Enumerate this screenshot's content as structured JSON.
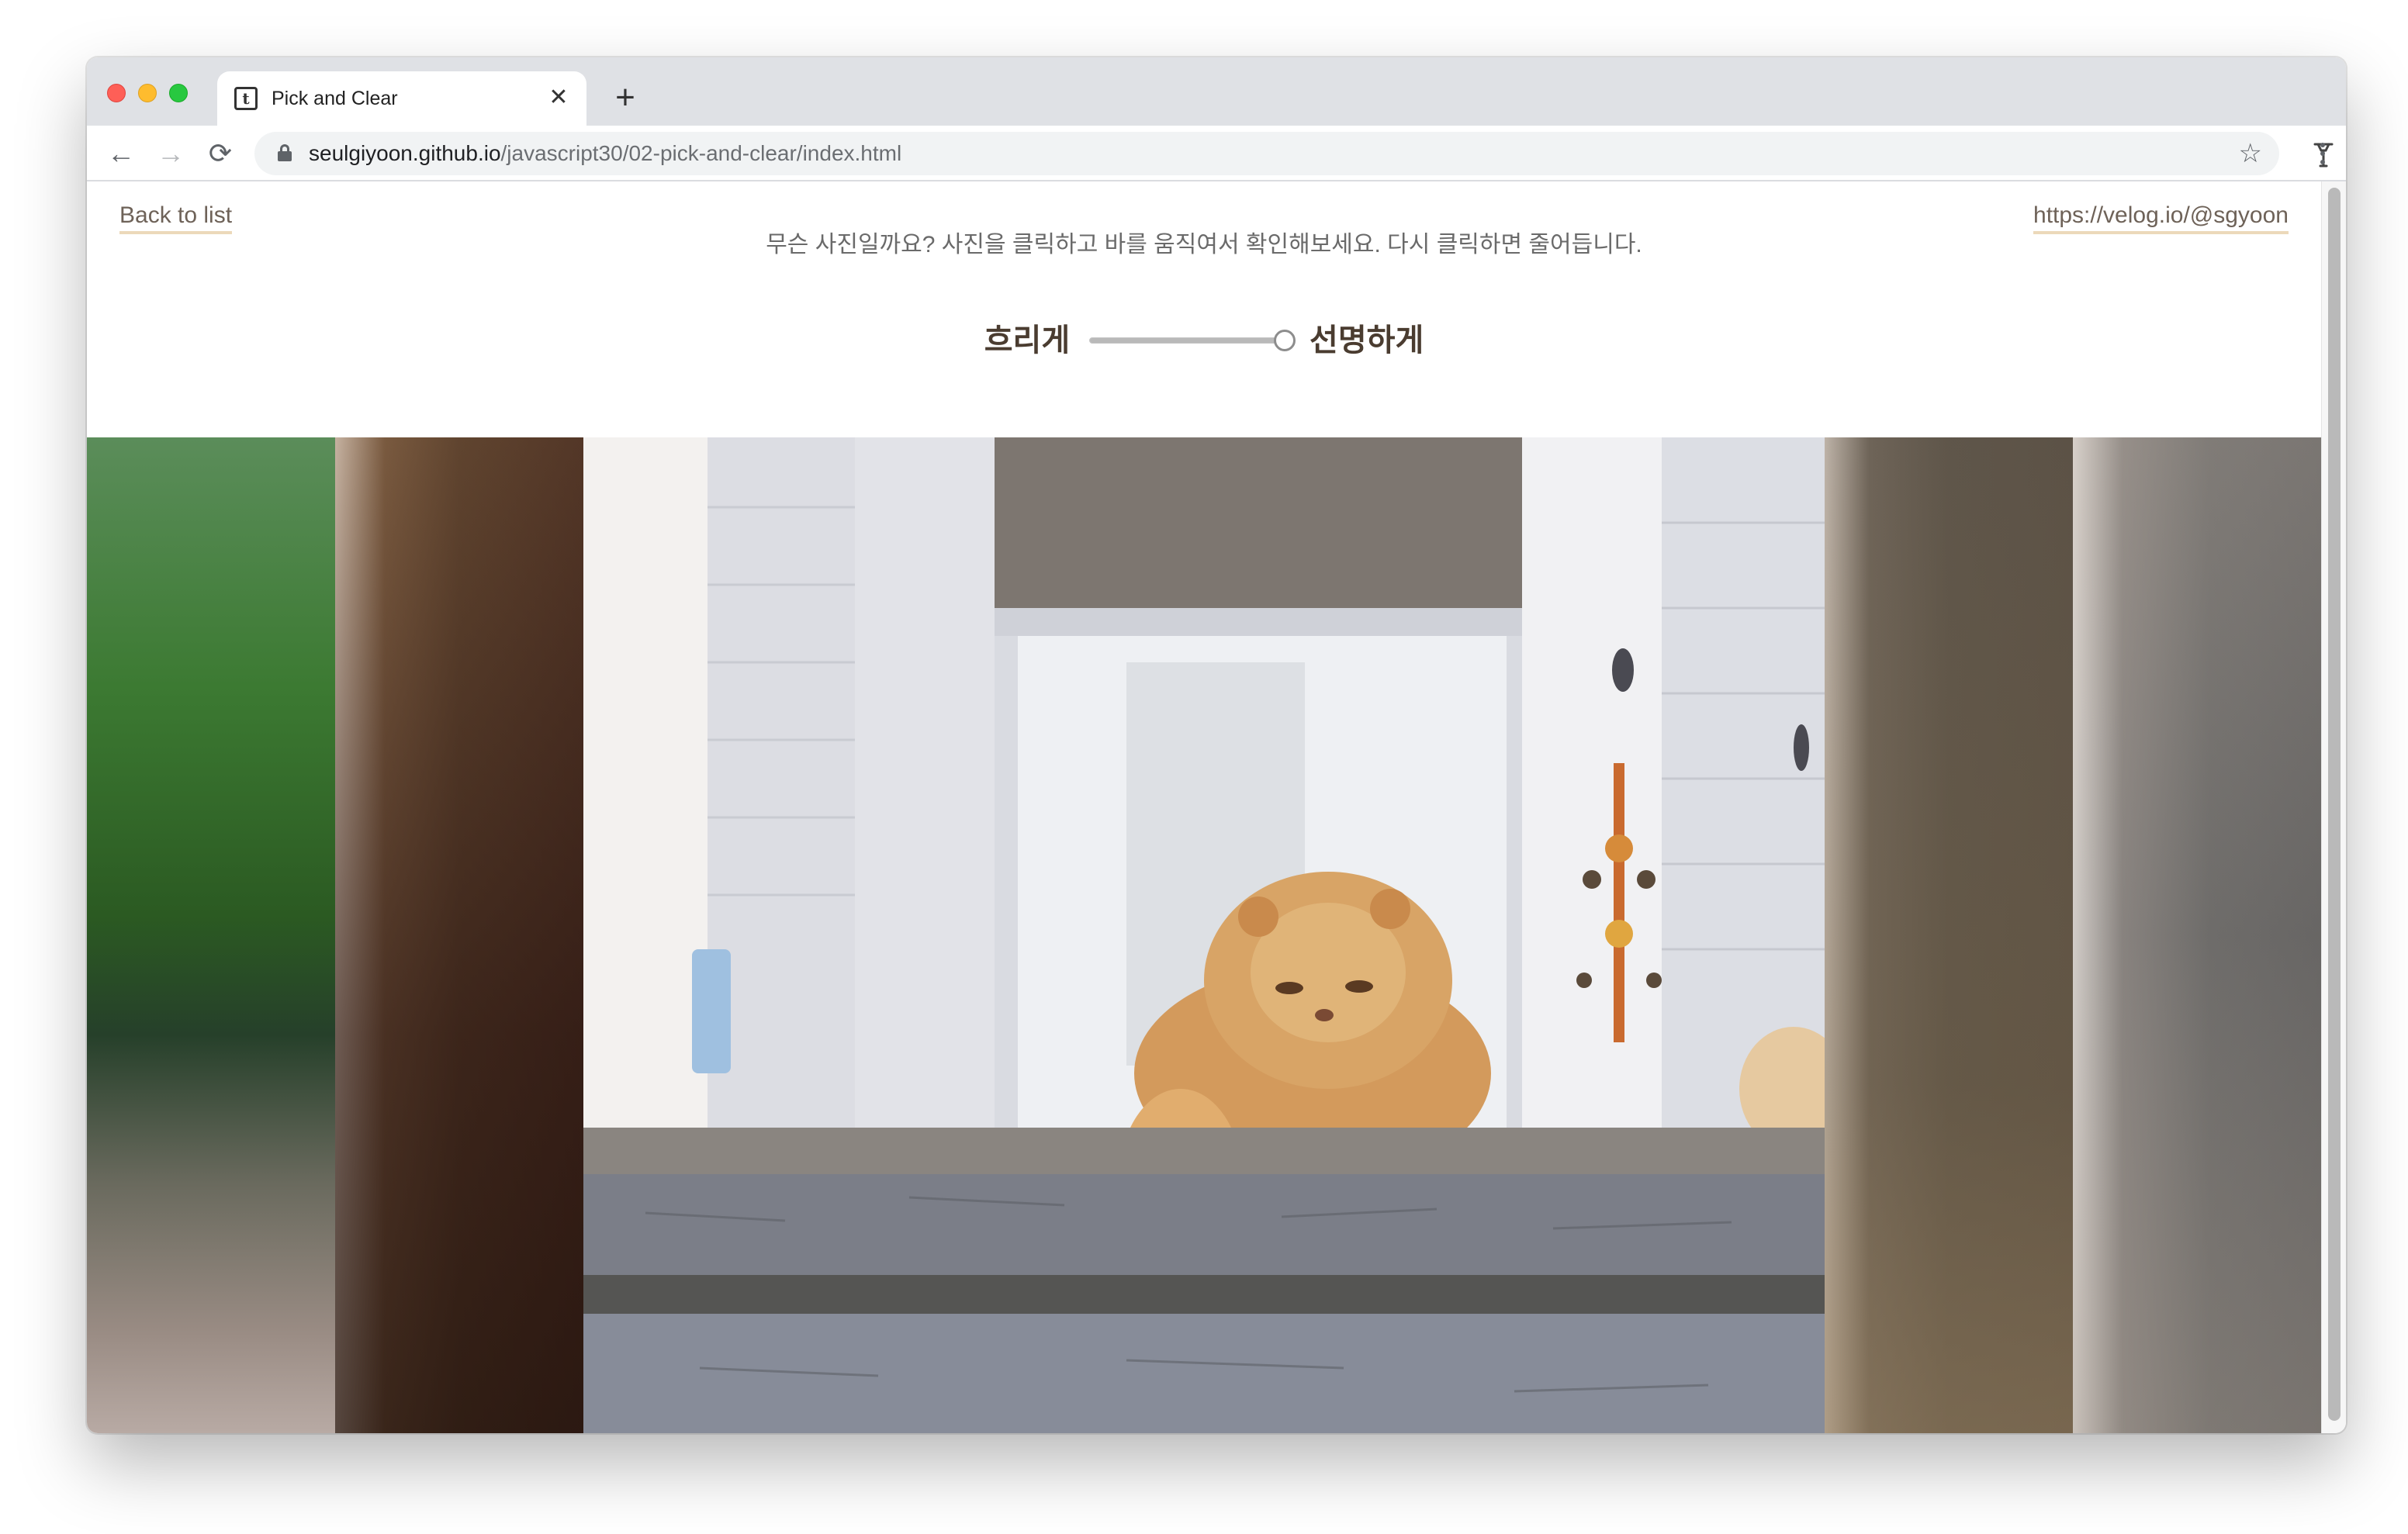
{
  "browser": {
    "tab_title": "Pick and Clear",
    "tab_favicon_letter": "t",
    "close_glyph": "✕",
    "new_tab_glyph": "+",
    "url_host": "seulgiyoon.github.io",
    "url_path": "/javascript30/02-pick-and-clear/index.html",
    "back_glyph": "←",
    "forward_glyph": "→",
    "reload_glyph": "⟳",
    "star_glyph": "☆"
  },
  "page": {
    "back_link": "Back to list",
    "author_link": "https://velog.io/@sgyoon",
    "instruction": "무슨 사진일까요? 사진을 클릭하고 바를 움직여서 확인해보세요. 다시 클릭하면 줄어듭니다.",
    "slider_left_label": "흐리게",
    "slider_right_label": "선명하게",
    "slider_value_fraction": 0.97
  },
  "gallery": {
    "panels": [
      {
        "id": "green-blurred",
        "state": "blurred"
      },
      {
        "id": "brown-blurred",
        "state": "blurred"
      },
      {
        "id": "cat-on-porch",
        "state": "sharp",
        "expanded": true
      },
      {
        "id": "taupe-blurred",
        "state": "blurred"
      },
      {
        "id": "grey-blurred",
        "state": "blurred"
      }
    ]
  },
  "colors": {
    "link_underline": "#ecd9ba",
    "label_text": "#4a3c30"
  }
}
